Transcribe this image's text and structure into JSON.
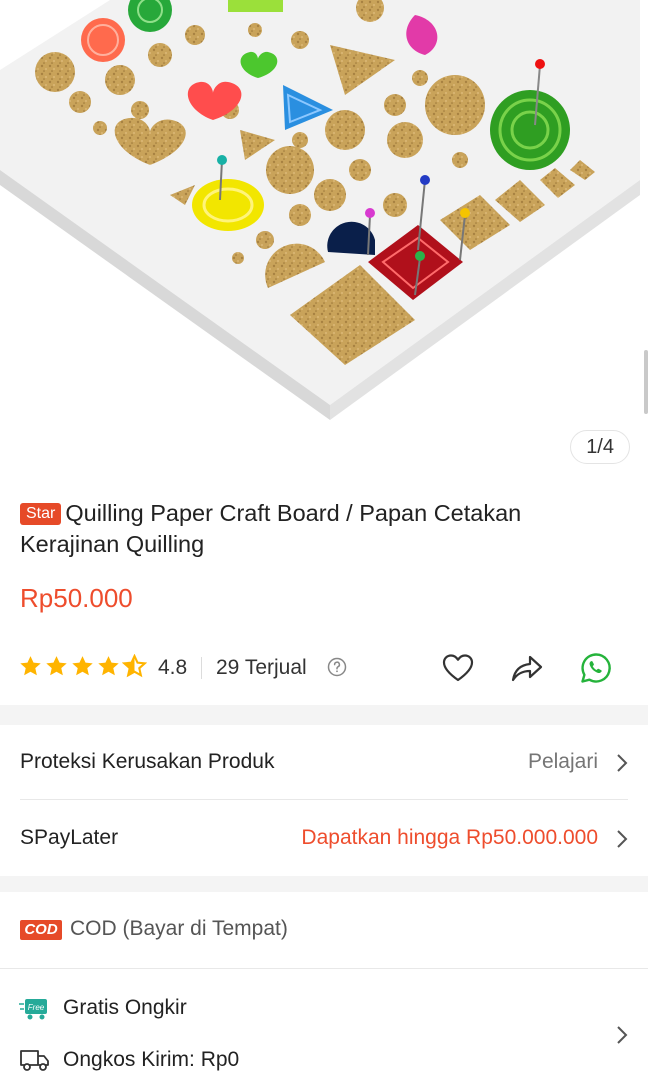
{
  "gallery": {
    "counter": "1/4"
  },
  "product": {
    "badge": "Star",
    "title": "Quilling Paper Craft Board / Papan Cetakan Kerajinan Quilling",
    "price": "Rp50.000",
    "rating": "4.8",
    "stars": 4.5,
    "sold": "29 Terjual"
  },
  "services": {
    "protection": {
      "label": "Proteksi Kerusakan Produk",
      "action": "Pelajari"
    },
    "paylater": {
      "label": "SPayLater",
      "offer": "Dapatkan hingga Rp50.000.000"
    }
  },
  "payment": {
    "cod_badge": "COD",
    "cod_text": "COD (Bayar di Tempat)"
  },
  "shipping": {
    "free_badge": "Free",
    "free_label": "Gratis Ongkir",
    "cost_label": "Ongkos Kirim: Rp0"
  },
  "colors": {
    "accent": "#ee4d2d",
    "badge": "#e64a28",
    "star": "#ffb400",
    "whatsapp": "#25b33b"
  },
  "icons": [
    "star-icon",
    "help-icon",
    "heart-icon",
    "share-icon",
    "whatsapp-icon",
    "chevron-right-icon",
    "free-shipping-icon",
    "truck-icon"
  ]
}
